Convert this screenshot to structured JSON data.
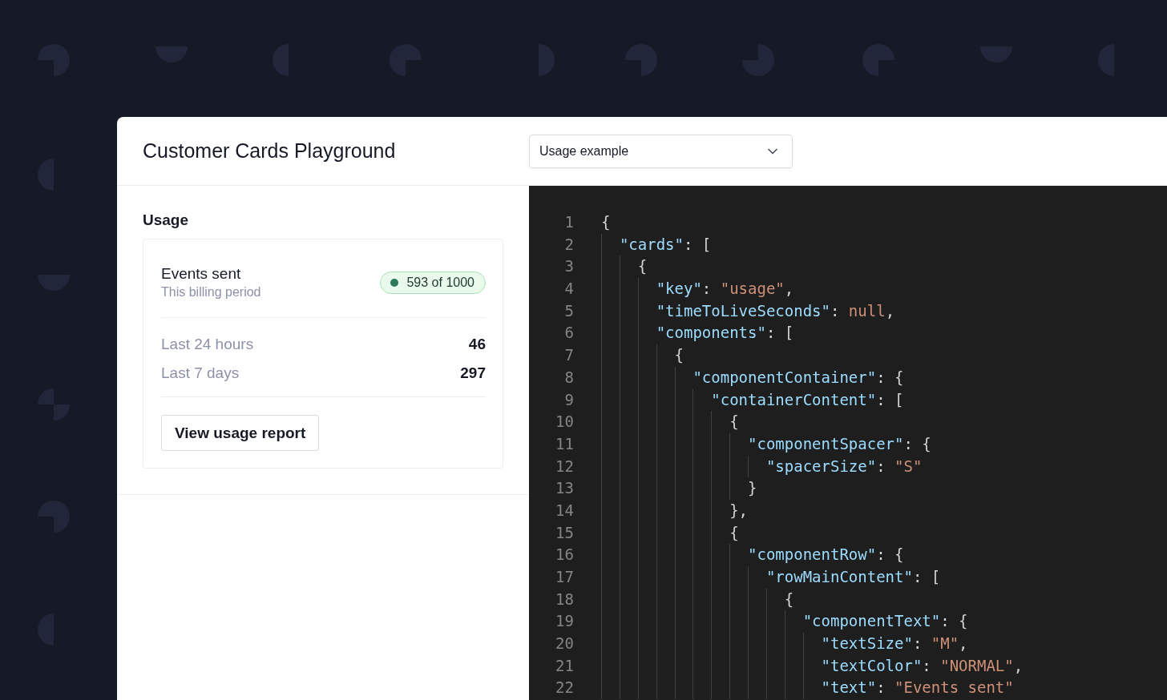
{
  "window": {
    "title": "Customer Cards Playground"
  },
  "example_select": {
    "value": "Usage example"
  },
  "usage": {
    "heading": "Usage",
    "card": {
      "title": "Events sent",
      "subtitle": "This billing period",
      "badge": "593 of 1000",
      "stats": [
        {
          "label": "Last 24 hours",
          "value": "46"
        },
        {
          "label": "Last 7 days",
          "value": "297"
        }
      ],
      "button": "View usage report"
    }
  },
  "code_editor": {
    "lines": [
      {
        "number": "1",
        "tokens": [
          {
            "kind": "punct",
            "text": "{"
          }
        ]
      },
      {
        "number": "2",
        "tokens": [
          {
            "kind": "key",
            "text": "  \"cards\""
          },
          {
            "kind": "punct",
            "text": ": ["
          }
        ]
      },
      {
        "number": "3",
        "tokens": [
          {
            "kind": "punct",
            "text": "    {"
          }
        ]
      },
      {
        "number": "4",
        "tokens": [
          {
            "kind": "key",
            "text": "      \"key\""
          },
          {
            "kind": "punct",
            "text": ": "
          },
          {
            "kind": "string",
            "text": "\"usage\""
          },
          {
            "kind": "punct",
            "text": ","
          }
        ]
      },
      {
        "number": "5",
        "tokens": [
          {
            "kind": "key",
            "text": "      \"timeToLiveSeconds\""
          },
          {
            "kind": "punct",
            "text": ": "
          },
          {
            "kind": "literal",
            "text": "null"
          },
          {
            "kind": "punct",
            "text": ","
          }
        ]
      },
      {
        "number": "6",
        "tokens": [
          {
            "kind": "key",
            "text": "      \"components\""
          },
          {
            "kind": "punct",
            "text": ": ["
          }
        ]
      },
      {
        "number": "7",
        "tokens": [
          {
            "kind": "punct",
            "text": "        {"
          }
        ]
      },
      {
        "number": "8",
        "tokens": [
          {
            "kind": "key",
            "text": "          \"componentContainer\""
          },
          {
            "kind": "punct",
            "text": ": {"
          }
        ]
      },
      {
        "number": "9",
        "tokens": [
          {
            "kind": "key",
            "text": "            \"containerContent\""
          },
          {
            "kind": "punct",
            "text": ": ["
          }
        ]
      },
      {
        "number": "10",
        "tokens": [
          {
            "kind": "punct",
            "text": "              {"
          }
        ]
      },
      {
        "number": "11",
        "tokens": [
          {
            "kind": "key",
            "text": "                \"componentSpacer\""
          },
          {
            "kind": "punct",
            "text": ": {"
          }
        ]
      },
      {
        "number": "12",
        "tokens": [
          {
            "kind": "key",
            "text": "                  \"spacerSize\""
          },
          {
            "kind": "punct",
            "text": ": "
          },
          {
            "kind": "string",
            "text": "\"S\""
          }
        ]
      },
      {
        "number": "13",
        "tokens": [
          {
            "kind": "punct",
            "text": "                }"
          }
        ]
      },
      {
        "number": "14",
        "tokens": [
          {
            "kind": "punct",
            "text": "              },"
          }
        ]
      },
      {
        "number": "15",
        "tokens": [
          {
            "kind": "punct",
            "text": "              {"
          }
        ]
      },
      {
        "number": "16",
        "tokens": [
          {
            "kind": "key",
            "text": "                \"componentRow\""
          },
          {
            "kind": "punct",
            "text": ": {"
          }
        ]
      },
      {
        "number": "17",
        "tokens": [
          {
            "kind": "key",
            "text": "                  \"rowMainContent\""
          },
          {
            "kind": "punct",
            "text": ": ["
          }
        ]
      },
      {
        "number": "18",
        "tokens": [
          {
            "kind": "punct",
            "text": "                    {"
          }
        ]
      },
      {
        "number": "19",
        "tokens": [
          {
            "kind": "key",
            "text": "                      \"componentText\""
          },
          {
            "kind": "punct",
            "text": ": {"
          }
        ]
      },
      {
        "number": "20",
        "tokens": [
          {
            "kind": "key",
            "text": "                        \"textSize\""
          },
          {
            "kind": "punct",
            "text": ": "
          },
          {
            "kind": "string",
            "text": "\"M\""
          },
          {
            "kind": "punct",
            "text": ","
          }
        ]
      },
      {
        "number": "21",
        "tokens": [
          {
            "kind": "key",
            "text": "                        \"textColor\""
          },
          {
            "kind": "punct",
            "text": ": "
          },
          {
            "kind": "string",
            "text": "\"NORMAL\""
          },
          {
            "kind": "punct",
            "text": ","
          }
        ]
      },
      {
        "number": "22",
        "tokens": [
          {
            "kind": "key",
            "text": "                        \"text\""
          },
          {
            "kind": "punct",
            "text": ": "
          },
          {
            "kind": "string",
            "text": "\"Events sent\""
          }
        ]
      }
    ]
  }
}
